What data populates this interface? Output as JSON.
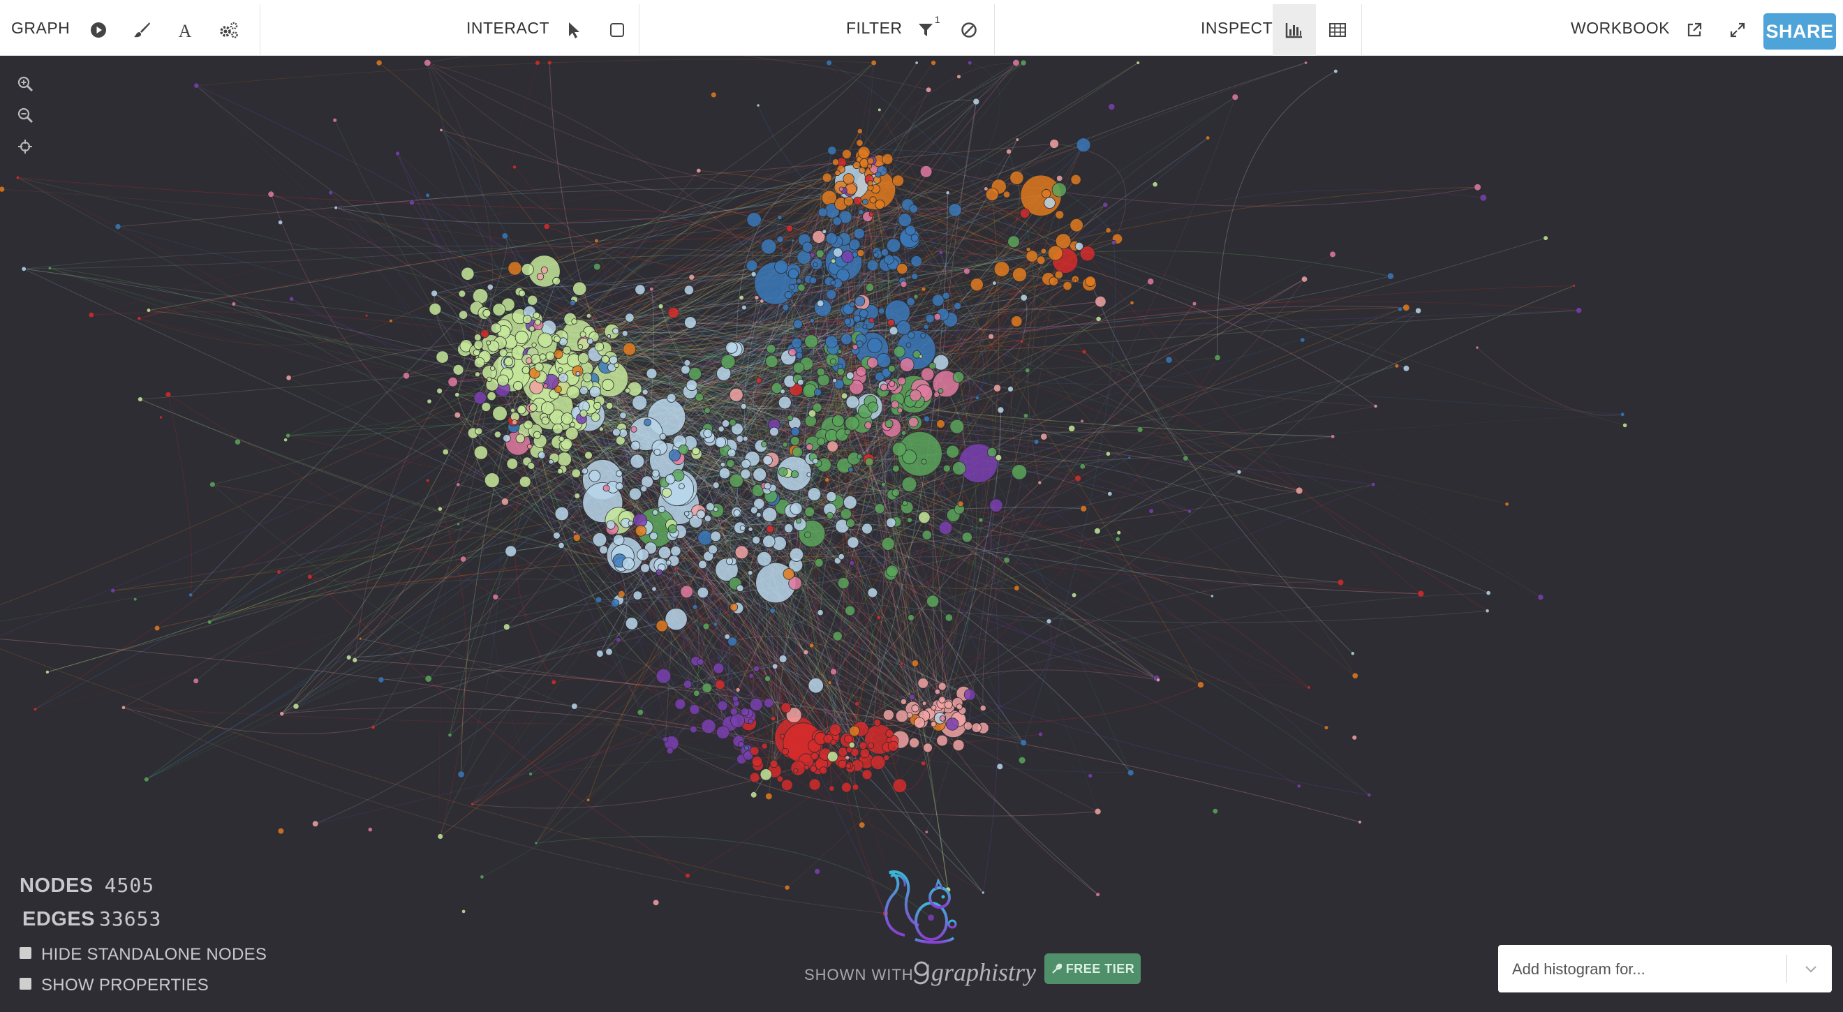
{
  "toolbar": {
    "graph_label": "GRAPH",
    "interact_label": "INTERACT",
    "filter_label": "FILTER",
    "filter_count": "1",
    "inspect_label": "INSPECT",
    "workbook_label": "WORKBOOK",
    "share_label": "SHARE"
  },
  "stats": {
    "nodes_label": "NODES",
    "nodes_value": "4505",
    "edges_label": "EDGES",
    "edges_value": "33653"
  },
  "options": {
    "hide_standalone_label": "HIDE STANDALONE NODES",
    "show_properties_label": "SHOW PROPERTIES"
  },
  "branding": {
    "shown_with": "SHOWN WITH",
    "brand": "graphistry",
    "tier": "FREE TIER"
  },
  "histogram": {
    "placeholder": "Add histogram for..."
  },
  "colors": {
    "background": "#2d2d33",
    "accent": "#4ea3d8",
    "cluster_palette": [
      "#c5e89a",
      "#b9d6ea",
      "#5aa55a",
      "#3a78b8",
      "#e27aa0",
      "#d62b2b",
      "#e07a1e",
      "#7a3fb0",
      "#f2a3a3"
    ]
  }
}
